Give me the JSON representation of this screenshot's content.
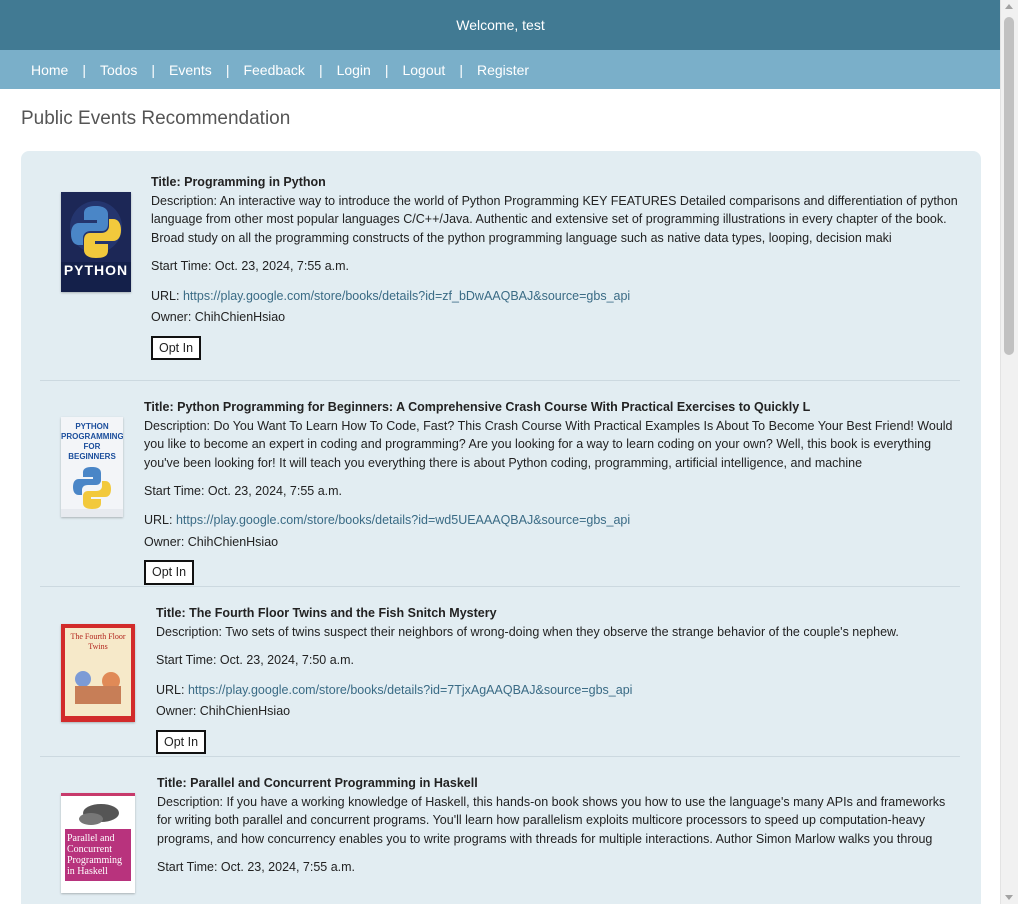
{
  "header": {
    "welcome": "Welcome, test"
  },
  "nav": {
    "home": "Home",
    "todos": "Todos",
    "events": "Events",
    "feedback": "Feedback",
    "login": "Login",
    "logout": "Logout",
    "register": "Register",
    "separator": "|"
  },
  "page": {
    "title": "Public Events Recommendation"
  },
  "labels": {
    "start": "Start Time:",
    "url": "URL:",
    "owner": "Owner:",
    "opt_in": "Opt In"
  },
  "events": [
    {
      "title": "Title: Programming in Python",
      "description": "Description: An interactive way to introduce the world of Python Programming KEY FEATURES Detailed comparisons and differentiation of python language from other most popular languages C/C++/Java. Authentic and extensive set of programming illustrations in every chapter of the book. Broad study on all the programming constructs of the python programming language such as native data types, looping, decision maki",
      "start_time": "Oct. 23, 2024, 7:55 a.m.",
      "url": "https://play.google.com/store/books/details?id=zf_bDwAAQBAJ&source=gbs_api",
      "owner": "ChihChienHsiao",
      "cover_text": "PYTHON"
    },
    {
      "title": "Title: Python Programming for Beginners: A Comprehensive Crash Course With Practical Exercises to Quickly L",
      "description": "Description: Do You Want To Learn How To Code, Fast? This Crash Course With Practical Examples Is About To Become Your Best Friend! Would you like to become an expert in coding and programming? Are you looking for a way to learn coding on your own? Well, this book is everything you've been looking for! It will teach you everything there is about Python coding, programming, artificial intelligence, and machine",
      "start_time": "Oct. 23, 2024, 7:55 a.m.",
      "url": "https://play.google.com/store/books/details?id=wd5UEAAAQBAJ&source=gbs_api",
      "owner": "ChihChienHsiao",
      "cover_text": "PYTHON PROGRAMMING FOR BEGINNERS"
    },
    {
      "title": "Title: The Fourth Floor Twins and the Fish Snitch Mystery",
      "description": "Description: Two sets of twins suspect their neighbors of wrong-doing when they observe the strange behavior of the couple's nephew.",
      "start_time": "Oct. 23, 2024, 7:50 a.m.",
      "url": "https://play.google.com/store/books/details?id=7TjxAgAAQBAJ&source=gbs_api",
      "owner": "ChihChienHsiao",
      "cover_text": "The Fourth Floor Twins"
    },
    {
      "title": "Title: Parallel and Concurrent Programming in Haskell",
      "description": "Description: If you have a working knowledge of Haskell, this hands-on book shows you how to use the language's many APIs and frameworks for writing both parallel and concurrent programs. You'll learn how parallelism exploits multicore processors to speed up computation-heavy programs, and how concurrency enables you to write programs with threads for multiple interactions. Author Simon Marlow walks you throug",
      "start_time": "Oct. 23, 2024, 7:55 a.m.",
      "url": "",
      "owner": "",
      "cover_text": "Parallel and Concurrent Programming in Haskell"
    }
  ],
  "colors": {
    "header_bg": "#417a93",
    "nav_bg": "#7aafc9",
    "card_bg": "#e2edf2",
    "link": "#3a6b85"
  }
}
